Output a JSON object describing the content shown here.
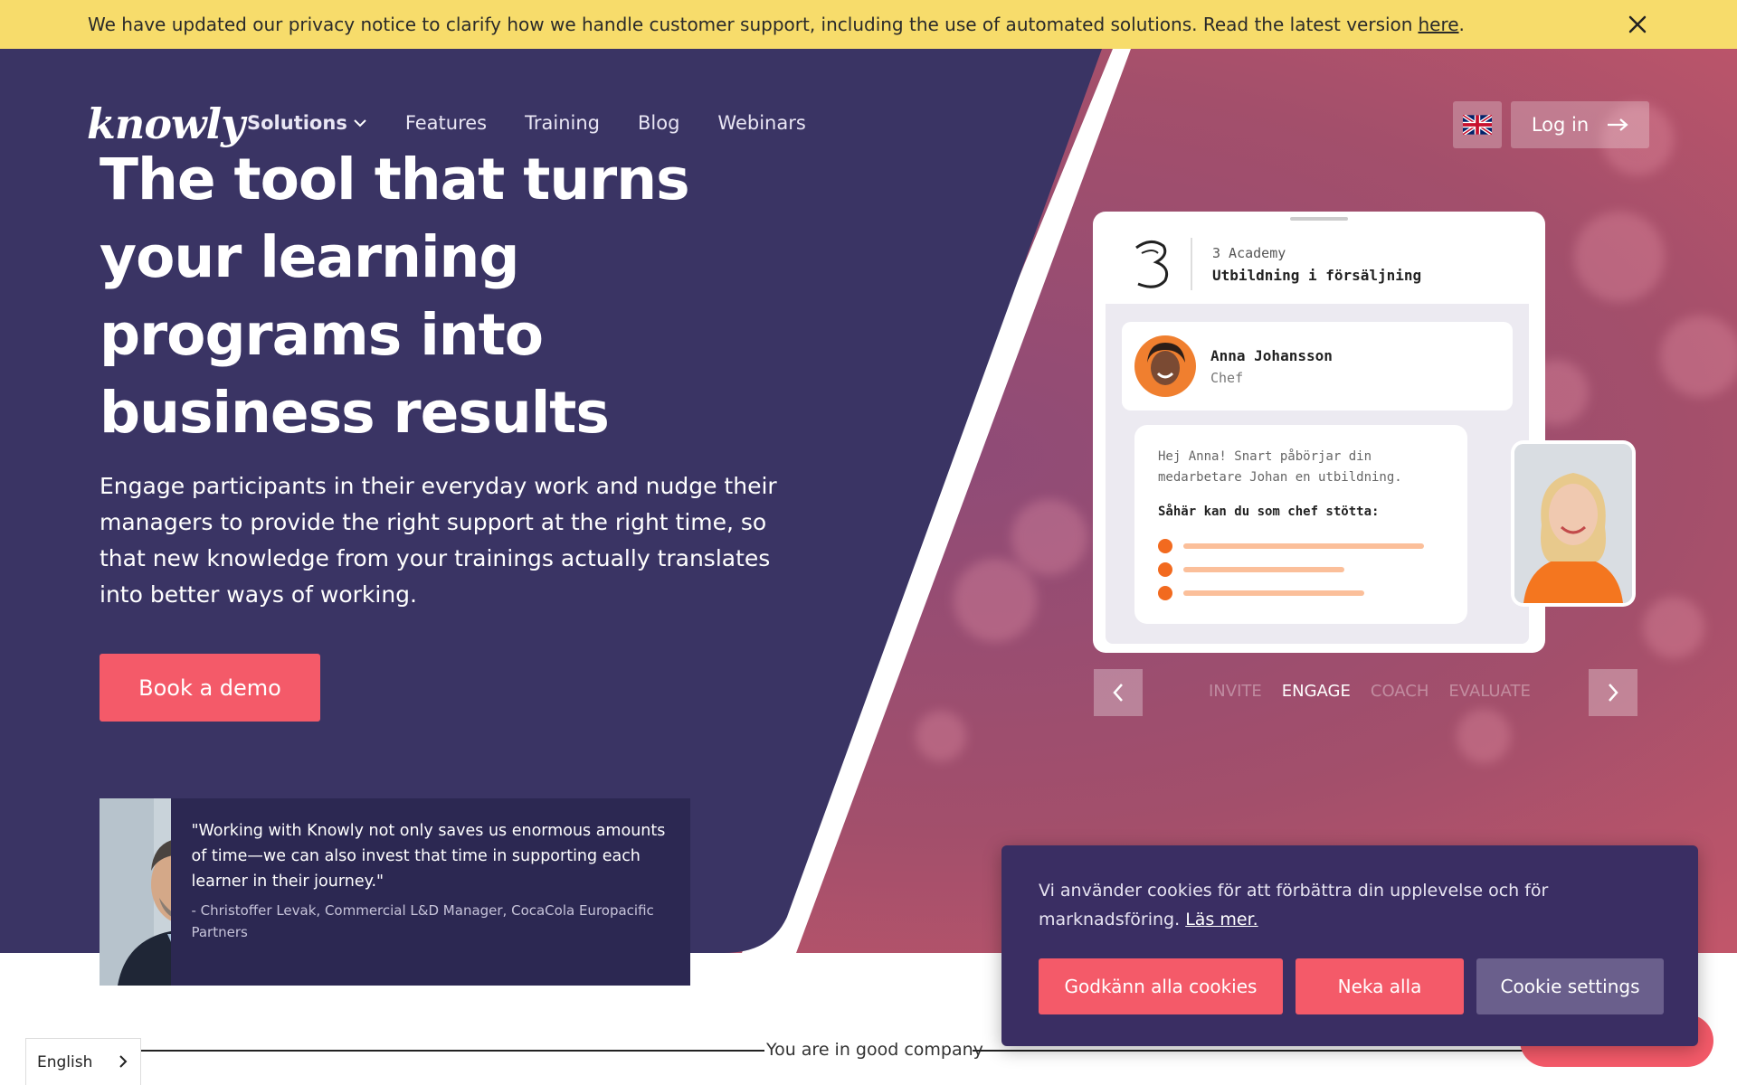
{
  "notice": {
    "text": "We have updated our privacy notice to clarify how we handle customer support, including the use of automated solutions. Read the latest version",
    "link": "here",
    "end": "."
  },
  "brand": {
    "logo": "knowly"
  },
  "nav": {
    "solutions": "Solutions",
    "features": "Features",
    "training": "Training",
    "blog": "Blog",
    "webinars": "Webinars"
  },
  "header": {
    "login": "Log in"
  },
  "hero": {
    "headline_1": "The tool that turns",
    "headline_2": "your learning",
    "headline_3": "programs into",
    "headline_4": "business results",
    "lead": "Engage participants in their everyday work and nudge their managers to provide the right support at the right time, so that new knowledge from your trainings actually translates into better ways of working.",
    "cta": "Book a demo"
  },
  "testimonial": {
    "quote": "\"Working with Knowly not only saves us enormous amounts of time—we can also invest that time in supporting each learner in their journey.\"",
    "author": "- Christoffer Levak, Commercial L&D Manager, CocaCola Europacific Partners"
  },
  "mockup": {
    "org": "3 Academy",
    "course": "Utbildning i försäljning",
    "person_name": "Anna Johansson",
    "person_role": "Chef",
    "message": "Hej Anna! Snart påbörjar din medarbetare Johan en utbildning.",
    "support_title": "Såhär kan du som chef stötta:"
  },
  "steps": [
    "INVITE",
    "ENGAGE",
    "COACH",
    "EVALUATE"
  ],
  "active_step": "ENGAGE",
  "section": {
    "good_company": "You are in good company"
  },
  "language": {
    "current": "English"
  },
  "cookie": {
    "message": "Vi använder cookies för att förbättra din upplevelse och för marknadsföring.",
    "link": "Läs mer.",
    "accept": "Godkänn alla cookies",
    "deny": "Neka alla",
    "settings": "Cookie settings"
  },
  "colors": {
    "notice_bg": "#f7dc6b",
    "hero_navy": "#3a3464",
    "accent_coral": "#f45a69",
    "cookie_bg": "#3a2e63"
  }
}
